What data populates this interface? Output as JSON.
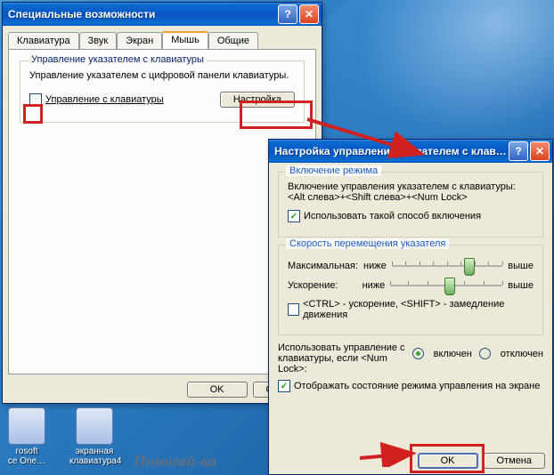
{
  "window1": {
    "title": "Специальные возможности",
    "tabs": [
      "Клавиатура",
      "Звук",
      "Экран",
      "Мышь",
      "Общие"
    ],
    "group_title": "Управление указателем с клавиатуры",
    "desc": "Управление указателем с цифровой панели клавиатуры.",
    "checkbox_label": "Управление с клавиатуры",
    "settings_btn": "Настройка",
    "ok": "OK",
    "cancel": "Отмена"
  },
  "window2": {
    "title": "Настройка управления указателем с клав…",
    "grp_enable": {
      "title": "Включение режима",
      "desc1": "Включение управления указателем с клавиатуры:",
      "desc2": "<Alt слева>+<Shift слева>+<Num Lock>",
      "checkbox": "Использовать такой способ включения"
    },
    "grp_speed": {
      "title": "Скорость перемещения указателя",
      "max_label": "Максимальная:",
      "accel_label": "Ускорение:",
      "low": "ниже",
      "high": "выше",
      "ctrl_shift": "<CTRL> - ускорение, <SHIFT> - замедление движения"
    },
    "numlock_label1": "Использовать управление с",
    "numlock_label2": "клавиатуры, если <Num Lock>:",
    "radio_on": "включен",
    "radio_off": "отключен",
    "show_state": "Отображать состояние режима управления на экране",
    "ok": "OK",
    "cancel": "Отмена"
  },
  "desktop": {
    "icon1": "rosoft\nce One…",
    "icon2": "экранная\nклавиатура4",
    "watermark": "Помогай-ка"
  }
}
